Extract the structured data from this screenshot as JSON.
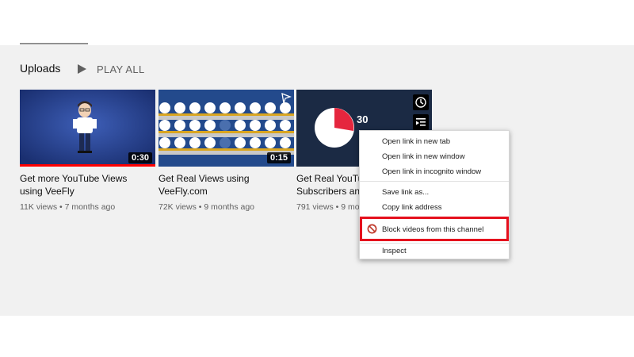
{
  "section": {
    "title": "Uploads",
    "play_all": "PLAY ALL"
  },
  "videos": [
    {
      "title": "Get more YouTube Views\nusing VeeFly",
      "views": "11K views",
      "age": "7 months ago",
      "duration": "0:30"
    },
    {
      "title": "Get Real Views using\nVeeFly.com",
      "views": "72K views",
      "age": "9 months ago",
      "duration": "0:15"
    },
    {
      "title": "Get Real YouTu\nSubscribers an",
      "views": "791 views",
      "age": "9 mo",
      "thumb_number": "30"
    }
  ],
  "context_menu": {
    "items": [
      "Open link in new tab",
      "Open link in new window",
      "Open link in incognito window",
      "Save link as...",
      "Copy link address",
      "Block videos from this channel",
      "Inspect"
    ]
  },
  "colors": {
    "accent_red": "#e5101d",
    "progress_red": "#ff0000",
    "thumb_blue": "#1f3c8a"
  }
}
